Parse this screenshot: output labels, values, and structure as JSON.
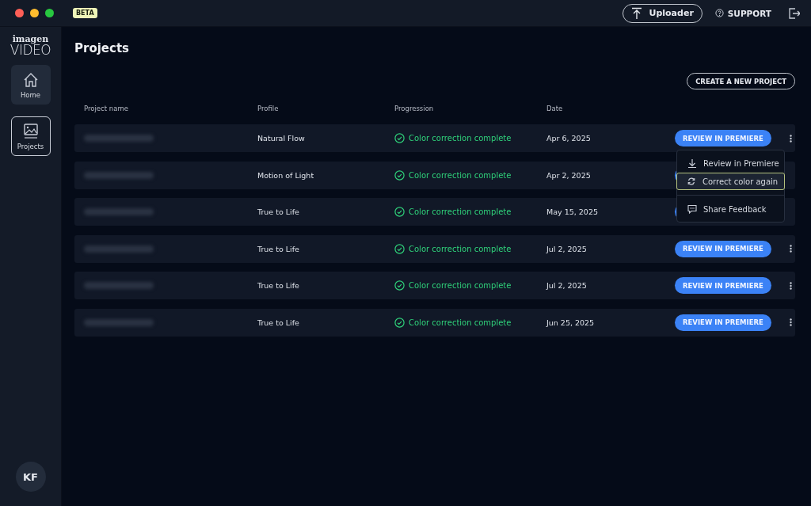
{
  "titlebar": {
    "badge": "BETA",
    "uploader_button": "Uploader",
    "support_link": "SUPPORT"
  },
  "sidebar": {
    "logo_top": "imagen",
    "logo_bottom": "VIDEO",
    "items": [
      {
        "label": "Home",
        "kind": "home",
        "selected": false,
        "hovered": true
      },
      {
        "label": "Projects",
        "kind": "projects",
        "selected": true,
        "hovered": false
      }
    ],
    "avatar": "KF"
  },
  "page": {
    "title": "Projects",
    "create_button": "CREATE A NEW PROJECT"
  },
  "table": {
    "columns": [
      "Project name",
      "Profile",
      "Progression",
      "Date"
    ],
    "rows": [
      {
        "profile": "Natural Flow",
        "progression": "Color correction complete",
        "date": "Apr 6, 2025",
        "review_button": "REVIEW IN PREMIERE",
        "menu_open": true
      },
      {
        "profile": "Motion of Light",
        "progression": "Color correction complete",
        "date": "Apr 2, 2025",
        "menu_open": false
      },
      {
        "profile": "True to Life",
        "progression": "Color correction complete",
        "date": "May 15, 2025",
        "menu_open": false
      },
      {
        "profile": "True to Life",
        "progression": "Color correction complete",
        "date": "Jul 2, 2025",
        "review_button": "REVIEW IN PREMIERE",
        "menu_open": false
      },
      {
        "profile": "True to Life",
        "progression": "Color correction complete",
        "date": "Jul 2, 2025",
        "review_button": "REVIEW IN PREMIERE",
        "menu_open": false
      },
      {
        "profile": "True to Life",
        "progression": "Color correction complete",
        "date": "Jun 25, 2025",
        "review_button": "REVIEW IN PREMIERE",
        "menu_open": false
      }
    ]
  },
  "context_menu": {
    "items": [
      {
        "label": "Review in Premiere",
        "kind": "download",
        "highlighted": false,
        "separator_before": false
      },
      {
        "label": "Correct color again",
        "kind": "refresh",
        "highlighted": true,
        "separator_before": false
      },
      {
        "label": "Share Feedback",
        "kind": "chat",
        "highlighted": false,
        "separator_before": true
      }
    ]
  }
}
